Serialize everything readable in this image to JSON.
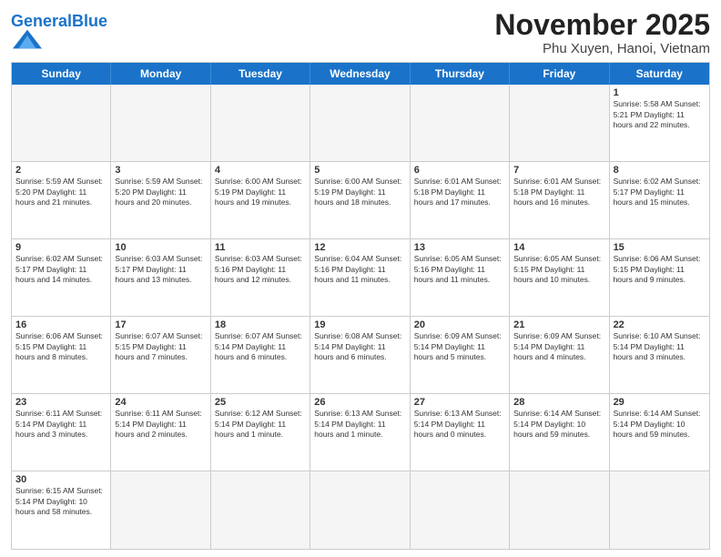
{
  "header": {
    "logo_general": "General",
    "logo_blue": "Blue",
    "month_title": "November 2025",
    "subtitle": "Phu Xuyen, Hanoi, Vietnam"
  },
  "day_headers": [
    "Sunday",
    "Monday",
    "Tuesday",
    "Wednesday",
    "Thursday",
    "Friday",
    "Saturday"
  ],
  "weeks": [
    [
      {
        "day": "",
        "empty": true,
        "info": ""
      },
      {
        "day": "",
        "empty": true,
        "info": ""
      },
      {
        "day": "",
        "empty": true,
        "info": ""
      },
      {
        "day": "",
        "empty": true,
        "info": ""
      },
      {
        "day": "",
        "empty": true,
        "info": ""
      },
      {
        "day": "",
        "empty": true,
        "info": ""
      },
      {
        "day": "1",
        "info": "Sunrise: 5:58 AM\nSunset: 5:21 PM\nDaylight: 11 hours\nand 22 minutes."
      }
    ],
    [
      {
        "day": "2",
        "info": "Sunrise: 5:59 AM\nSunset: 5:20 PM\nDaylight: 11 hours\nand 21 minutes."
      },
      {
        "day": "3",
        "info": "Sunrise: 5:59 AM\nSunset: 5:20 PM\nDaylight: 11 hours\nand 20 minutes."
      },
      {
        "day": "4",
        "info": "Sunrise: 6:00 AM\nSunset: 5:19 PM\nDaylight: 11 hours\nand 19 minutes."
      },
      {
        "day": "5",
        "info": "Sunrise: 6:00 AM\nSunset: 5:19 PM\nDaylight: 11 hours\nand 18 minutes."
      },
      {
        "day": "6",
        "info": "Sunrise: 6:01 AM\nSunset: 5:18 PM\nDaylight: 11 hours\nand 17 minutes."
      },
      {
        "day": "7",
        "info": "Sunrise: 6:01 AM\nSunset: 5:18 PM\nDaylight: 11 hours\nand 16 minutes."
      },
      {
        "day": "8",
        "info": "Sunrise: 6:02 AM\nSunset: 5:17 PM\nDaylight: 11 hours\nand 15 minutes."
      }
    ],
    [
      {
        "day": "9",
        "info": "Sunrise: 6:02 AM\nSunset: 5:17 PM\nDaylight: 11 hours\nand 14 minutes."
      },
      {
        "day": "10",
        "info": "Sunrise: 6:03 AM\nSunset: 5:17 PM\nDaylight: 11 hours\nand 13 minutes."
      },
      {
        "day": "11",
        "info": "Sunrise: 6:03 AM\nSunset: 5:16 PM\nDaylight: 11 hours\nand 12 minutes."
      },
      {
        "day": "12",
        "info": "Sunrise: 6:04 AM\nSunset: 5:16 PM\nDaylight: 11 hours\nand 11 minutes."
      },
      {
        "day": "13",
        "info": "Sunrise: 6:05 AM\nSunset: 5:16 PM\nDaylight: 11 hours\nand 11 minutes."
      },
      {
        "day": "14",
        "info": "Sunrise: 6:05 AM\nSunset: 5:15 PM\nDaylight: 11 hours\nand 10 minutes."
      },
      {
        "day": "15",
        "info": "Sunrise: 6:06 AM\nSunset: 5:15 PM\nDaylight: 11 hours\nand 9 minutes."
      }
    ],
    [
      {
        "day": "16",
        "info": "Sunrise: 6:06 AM\nSunset: 5:15 PM\nDaylight: 11 hours\nand 8 minutes."
      },
      {
        "day": "17",
        "info": "Sunrise: 6:07 AM\nSunset: 5:15 PM\nDaylight: 11 hours\nand 7 minutes."
      },
      {
        "day": "18",
        "info": "Sunrise: 6:07 AM\nSunset: 5:14 PM\nDaylight: 11 hours\nand 6 minutes."
      },
      {
        "day": "19",
        "info": "Sunrise: 6:08 AM\nSunset: 5:14 PM\nDaylight: 11 hours\nand 6 minutes."
      },
      {
        "day": "20",
        "info": "Sunrise: 6:09 AM\nSunset: 5:14 PM\nDaylight: 11 hours\nand 5 minutes."
      },
      {
        "day": "21",
        "info": "Sunrise: 6:09 AM\nSunset: 5:14 PM\nDaylight: 11 hours\nand 4 minutes."
      },
      {
        "day": "22",
        "info": "Sunrise: 6:10 AM\nSunset: 5:14 PM\nDaylight: 11 hours\nand 3 minutes."
      }
    ],
    [
      {
        "day": "23",
        "info": "Sunrise: 6:11 AM\nSunset: 5:14 PM\nDaylight: 11 hours\nand 3 minutes."
      },
      {
        "day": "24",
        "info": "Sunrise: 6:11 AM\nSunset: 5:14 PM\nDaylight: 11 hours\nand 2 minutes."
      },
      {
        "day": "25",
        "info": "Sunrise: 6:12 AM\nSunset: 5:14 PM\nDaylight: 11 hours\nand 1 minute."
      },
      {
        "day": "26",
        "info": "Sunrise: 6:13 AM\nSunset: 5:14 PM\nDaylight: 11 hours\nand 1 minute."
      },
      {
        "day": "27",
        "info": "Sunrise: 6:13 AM\nSunset: 5:14 PM\nDaylight: 11 hours\nand 0 minutes."
      },
      {
        "day": "28",
        "info": "Sunrise: 6:14 AM\nSunset: 5:14 PM\nDaylight: 10 hours\nand 59 minutes."
      },
      {
        "day": "29",
        "info": "Sunrise: 6:14 AM\nSunset: 5:14 PM\nDaylight: 10 hours\nand 59 minutes."
      }
    ],
    [
      {
        "day": "30",
        "info": "Sunrise: 6:15 AM\nSunset: 5:14 PM\nDaylight: 10 hours\nand 58 minutes."
      },
      {
        "day": "",
        "empty": true,
        "info": ""
      },
      {
        "day": "",
        "empty": true,
        "info": ""
      },
      {
        "day": "",
        "empty": true,
        "info": ""
      },
      {
        "day": "",
        "empty": true,
        "info": ""
      },
      {
        "day": "",
        "empty": true,
        "info": ""
      },
      {
        "day": "",
        "empty": true,
        "info": ""
      }
    ]
  ]
}
